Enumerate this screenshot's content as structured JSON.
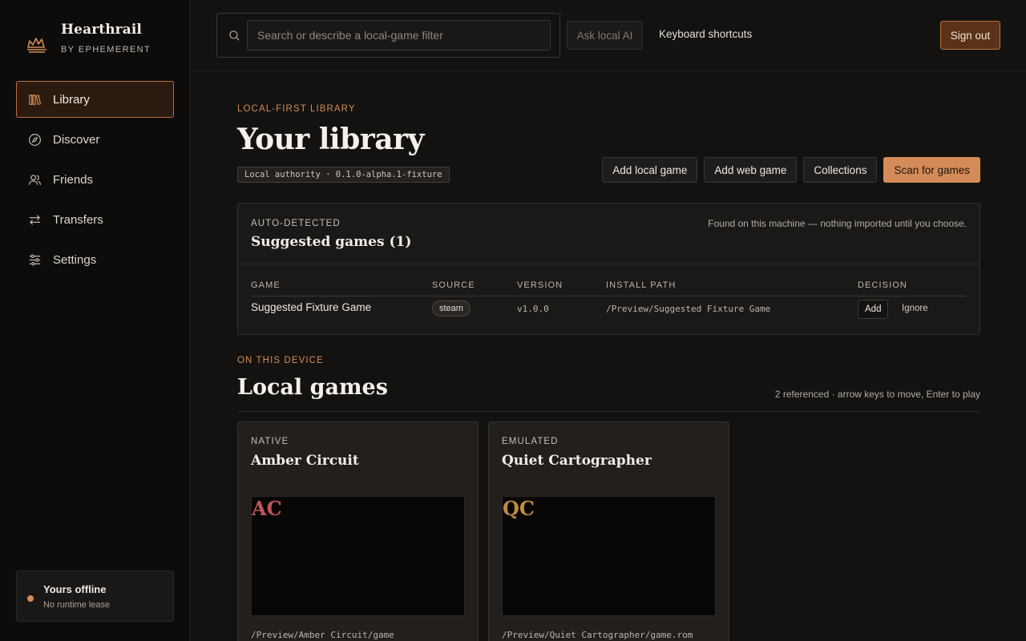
{
  "brand": {
    "name": "Hearthrail",
    "sub": "BY EPHEMERENT"
  },
  "nav": [
    {
      "label": "Library",
      "icon": "library-icon",
      "active": true
    },
    {
      "label": "Discover",
      "icon": "compass-icon"
    },
    {
      "label": "Friends",
      "icon": "users-icon"
    },
    {
      "label": "Transfers",
      "icon": "transfer-icon"
    },
    {
      "label": "Settings",
      "icon": "sliders-icon"
    }
  ],
  "status": {
    "title": "Yours offline",
    "sub": "No runtime lease",
    "color": "#d48b57"
  },
  "topbar": {
    "search_placeholder": "Search or describe a local-game filter",
    "ask_label": "Ask local AI",
    "shortcuts_label": "Keyboard shortcuts",
    "signout_label": "Sign out"
  },
  "header": {
    "eyebrow": "LOCAL-FIRST LIBRARY",
    "title": "Your library",
    "version": "Local authority · 0.1.0-alpha.1-fixture",
    "actions": [
      "Add local game",
      "Add web game",
      "Collections",
      "Scan for games"
    ]
  },
  "suggested": {
    "eyebrow": "AUTO-DETECTED",
    "title": "Suggested games (1)",
    "note": "Found on this machine — nothing imported until you choose.",
    "columns": [
      "GAME",
      "SOURCE",
      "VERSION",
      "INSTALL PATH",
      "DECISION"
    ],
    "rows": [
      {
        "game": "Suggested Fixture Game",
        "source": "steam",
        "version": "v1.0.0",
        "path": "/Preview/Suggested Fixture Game",
        "add": "Add",
        "ignore": "Ignore"
      }
    ]
  },
  "local": {
    "eyebrow": "ON THIS DEVICE",
    "title": "Local games",
    "meta": "2 referenced · arrow keys to move, Enter to play",
    "games": [
      {
        "kind": "NATIVE",
        "title": "Amber Circuit",
        "initials": "AC",
        "color": "#c0565a",
        "path": "/Preview/Amber Circuit/game"
      },
      {
        "kind": "EMULATED",
        "title": "Quiet Cartographer",
        "initials": "QC",
        "color": "#c08a3e",
        "path": "/Preview/Quiet Cartographer/game.rom"
      }
    ]
  },
  "accent": "#d48b57"
}
